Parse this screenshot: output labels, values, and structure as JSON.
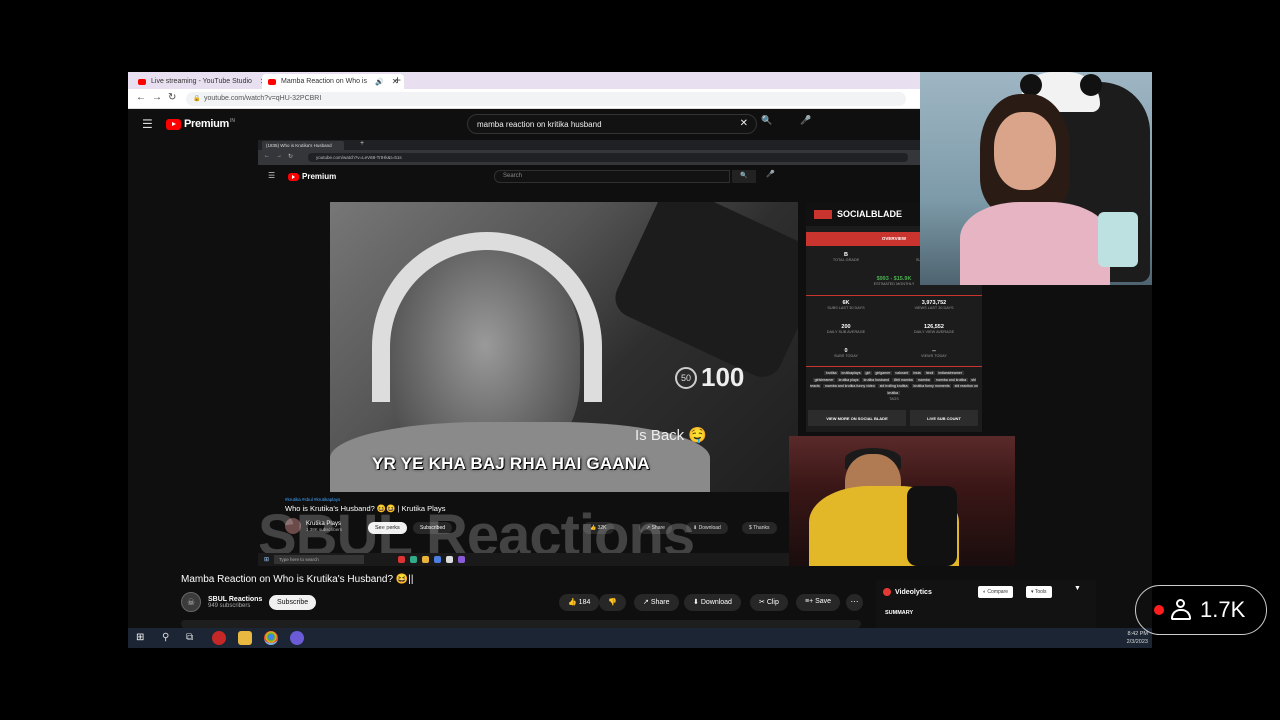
{
  "browser": {
    "tabs": [
      {
        "label": "Live streaming - YouTube Studio"
      },
      {
        "label": "Mamba Reaction on Who is"
      }
    ],
    "url": "youtube.com/watch?v=qHU-32PCBRI"
  },
  "yt_header": {
    "brand": "Premium",
    "region": "IN",
    "search_value": "mamba reaction on kritika husband"
  },
  "inner_browser": {
    "tab_label": "(1835) Who is Krutika's Husband",
    "url": "youtube.com/watch?v=LeV68-TrtHk&t=51s",
    "brand": "Premium",
    "region": "IN",
    "search_placeholder": "Search"
  },
  "video": {
    "score_badge": "50",
    "score": "100",
    "overlay_text": "Is Back 🤤",
    "subtitle": "YR YE KHA BAJ RHA HAI GAANA"
  },
  "inner_video": {
    "hashtags": "#krutika #sbul #krutikaplays",
    "title": "Who is Krutika's Husband? 😆😆 | Krutika Plays",
    "channel": "Krutika Plays",
    "subs": "1.38K subscribers",
    "perks": "See perks",
    "subscribed": "Subscribed",
    "likes": "32K",
    "share": "Share",
    "download": "Download",
    "thanks": "Thanks",
    "watermark": "SBUL Reactions",
    "taskbar_search": "Type here to search"
  },
  "socialblade": {
    "brand": "SOCIALBLADE",
    "overview": "OVERVIEW",
    "grade": {
      "v": "B",
      "l": "TOTAL GRADE"
    },
    "rank": {
      "v": "1,609th",
      "l": "SUBSCRIBER RANK"
    },
    "monthly": {
      "v": "$993 - $15.9K",
      "l": "ESTIMATED MONTHLY"
    },
    "subs30": {
      "v": "6K",
      "l": "SUBS LAST 30 DAYS"
    },
    "views30": {
      "v": "3,973,752",
      "l": "VIEWS LAST 30 DAYS"
    },
    "dailysub": {
      "v": "200",
      "l": "DAILY SUB AVERAGE"
    },
    "dailyview": {
      "v": "126,552",
      "l": "DAILY VIEW AVERAGE"
    },
    "substoday": {
      "v": "0",
      "l": "SUBS TODAY"
    },
    "viewstoday": {
      "v": "--",
      "l": "VIEWS TODAY"
    },
    "tags": [
      "krutika",
      "krutikaplays",
      "girl",
      "girlgamer",
      "valorant",
      "insta",
      "hindi",
      "indianstreamer",
      "girlstreamer",
      "krutika plays",
      "krutika husband",
      "8bit mamba",
      "mamba",
      "mamba and krutika",
      "sbl reacts",
      "mamba and krutika funny video",
      "sbl trolling krutika",
      "krutika funny moments",
      "sbl reaction on krutika"
    ],
    "tags_label": "TAGS",
    "view_more": "VIEW MORE ON SOCIAL BLADE",
    "live_count": "LIVE SUB COUNT"
  },
  "main_video": {
    "title": "Mamba Reaction on Who is Krutika's Husband? 😆||",
    "channel": "SBUL Reactions",
    "subs": "949 subscribers",
    "subscribe": "Subscribe",
    "likes": "184",
    "share": "Share",
    "download": "Download",
    "clip": "Clip",
    "save": "Save",
    "more": "⋯"
  },
  "videolytics": {
    "brand": "Videolytics",
    "compare": "Compare",
    "tools": "Tools",
    "summary": "SUMMARY"
  },
  "taskbar": {
    "time": "8:42 PM",
    "date": "2/3/2023"
  },
  "viewers": {
    "count": "1.7K"
  }
}
